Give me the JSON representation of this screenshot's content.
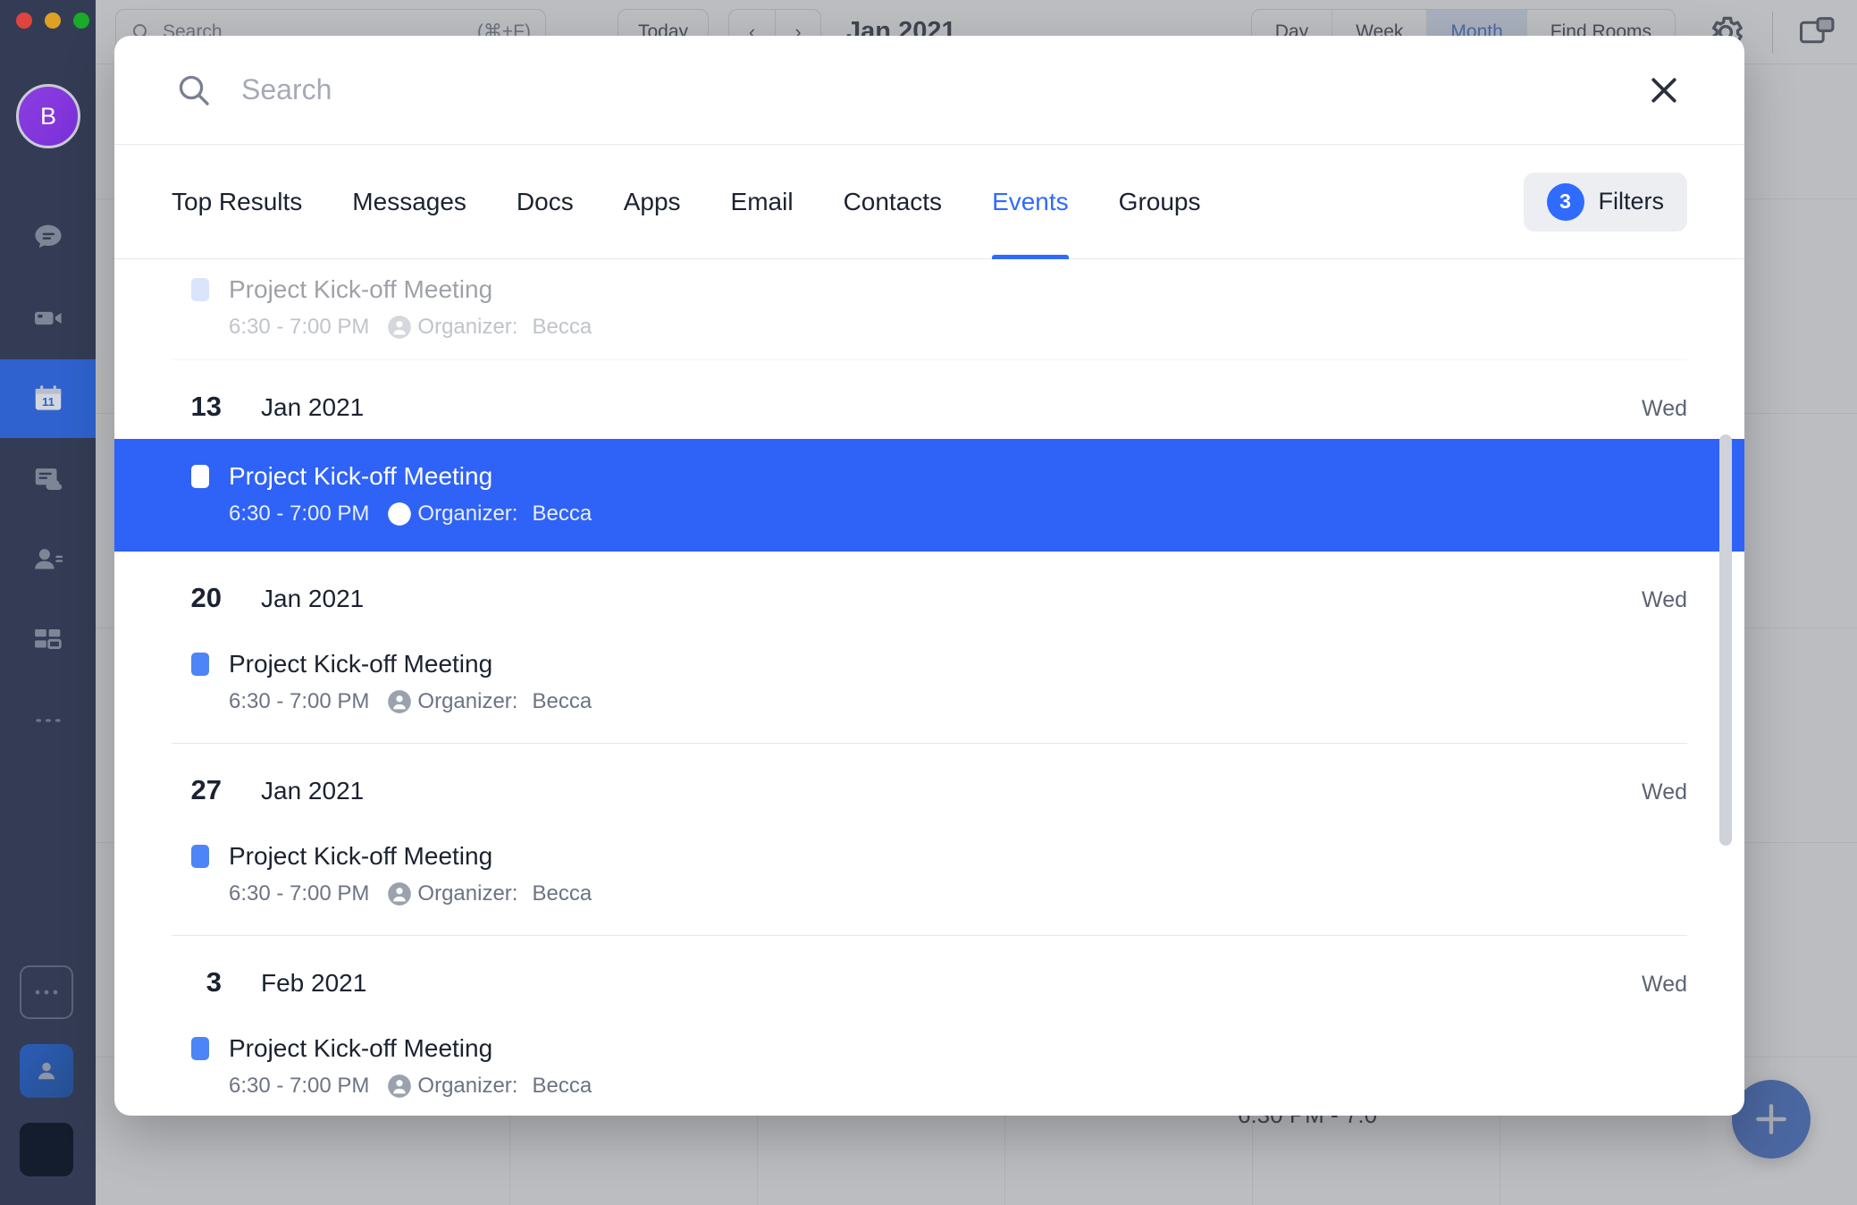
{
  "background": {
    "search_placeholder": "Search",
    "search_shortcut": "(⌘+F)",
    "today_label": "Today",
    "prev_label": "‹",
    "next_label": "›",
    "month_label": "Jan 2021",
    "view_options": [
      "Day",
      "Week",
      "Month"
    ],
    "active_view": "Month",
    "find_rooms_label": "Find Rooms",
    "gear_icon": "gear-icon",
    "panel_icon": "panel-layout-icon",
    "fab_icon": "plus-icon",
    "event_snippet": "6:30 PM - 7:0"
  },
  "sidebar": {
    "avatar_initial": "B",
    "items": [
      {
        "name": "chat",
        "icon": "chat-bubble-icon",
        "active": false
      },
      {
        "name": "video",
        "icon": "video-camera-icon",
        "active": false
      },
      {
        "name": "calendar",
        "icon": "calendar-icon",
        "active": true,
        "badge": "11"
      },
      {
        "name": "notes",
        "icon": "notes-cloud-icon",
        "active": false
      },
      {
        "name": "contacts",
        "icon": "contact-person-icon",
        "active": false
      },
      {
        "name": "apps",
        "icon": "apps-grid-icon",
        "active": false
      },
      {
        "name": "more",
        "icon": "ellipsis-icon",
        "active": false
      }
    ],
    "bottom_items": [
      {
        "name": "more-apps",
        "icon": "ellipsis-box-icon"
      },
      {
        "name": "profile",
        "icon": "person-square-icon"
      },
      {
        "name": "dark-tile",
        "icon": "blank-square-icon"
      }
    ]
  },
  "modal": {
    "search_placeholder": "Search",
    "search_value": "",
    "search_icon": "search-icon",
    "close_icon": "close-icon",
    "tabs": [
      {
        "label": "Top Results",
        "active": false
      },
      {
        "label": "Messages",
        "active": false
      },
      {
        "label": "Docs",
        "active": false
      },
      {
        "label": "Apps",
        "active": false
      },
      {
        "label": "Email",
        "active": false
      },
      {
        "label": "Contacts",
        "active": false
      },
      {
        "label": "Events",
        "active": true
      },
      {
        "label": "Groups",
        "active": false
      }
    ],
    "filters": {
      "count": "3",
      "label": "Filters"
    },
    "partial_event": {
      "title": "Project Kick-off Meeting",
      "time": "6:30 - 7:00 PM",
      "organizer_label": "Organizer:",
      "organizer_name": "Becca"
    },
    "groups": [
      {
        "day": "13",
        "month": "Jan 2021",
        "weekday": "Wed",
        "selected": true,
        "events": [
          {
            "title": "Project Kick-off Meeting",
            "time": "6:30 - 7:00 PM",
            "organizer_label": "Organizer:",
            "organizer_name": "Becca",
            "selected": true
          }
        ]
      },
      {
        "day": "20",
        "month": "Jan 2021",
        "weekday": "Wed",
        "selected": false,
        "events": [
          {
            "title": "Project Kick-off Meeting",
            "time": "6:30 - 7:00 PM",
            "organizer_label": "Organizer:",
            "organizer_name": "Becca",
            "selected": false
          }
        ]
      },
      {
        "day": "27",
        "month": "Jan 2021",
        "weekday": "Wed",
        "selected": false,
        "events": [
          {
            "title": "Project Kick-off Meeting",
            "time": "6:30 - 7:00 PM",
            "organizer_label": "Organizer:",
            "organizer_name": "Becca",
            "selected": false
          }
        ]
      },
      {
        "day": "3",
        "month": "Feb 2021",
        "weekday": "Wed",
        "selected": false,
        "events": [
          {
            "title": "Project Kick-off Meeting",
            "time": "6:30 - 7:00 PM",
            "organizer_label": "Organizer:",
            "organizer_name": "Becca",
            "selected": false
          }
        ]
      }
    ]
  },
  "colors": {
    "accent_blue": "#2f6bff",
    "selected_row": "#2f62f7",
    "rail_bg": "#333c54",
    "rail_active": "#2f62cf",
    "fab": "#2f5fc4",
    "avatar": "#7b2fd8"
  }
}
